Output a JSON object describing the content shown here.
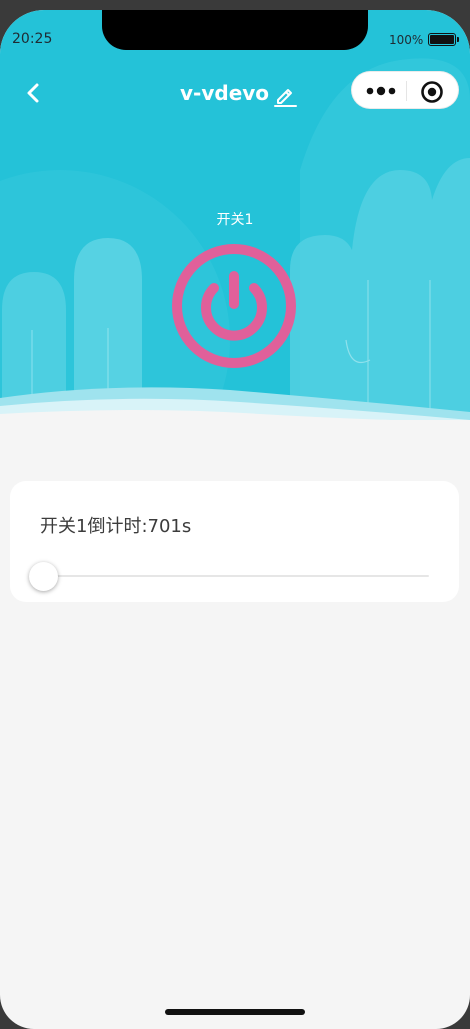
{
  "status_bar": {
    "time": "20:25",
    "battery": "100%"
  },
  "nav": {
    "title": "v-vdevo"
  },
  "device": {
    "switch_label": "开关1",
    "switch_on": true
  },
  "countdown": {
    "label": "开关1倒计时:701s",
    "slider_value_fraction": 0
  },
  "colors": {
    "header_bg": "#24c2d8",
    "power_icon": "#e0609a",
    "page_bg": "#f5f5f5",
    "card_bg": "#ffffff"
  },
  "icons": {
    "back": "chevron-left-icon",
    "edit": "pencil-icon",
    "more": "more-dots-icon",
    "close": "target-circle-icon",
    "power": "power-icon"
  }
}
